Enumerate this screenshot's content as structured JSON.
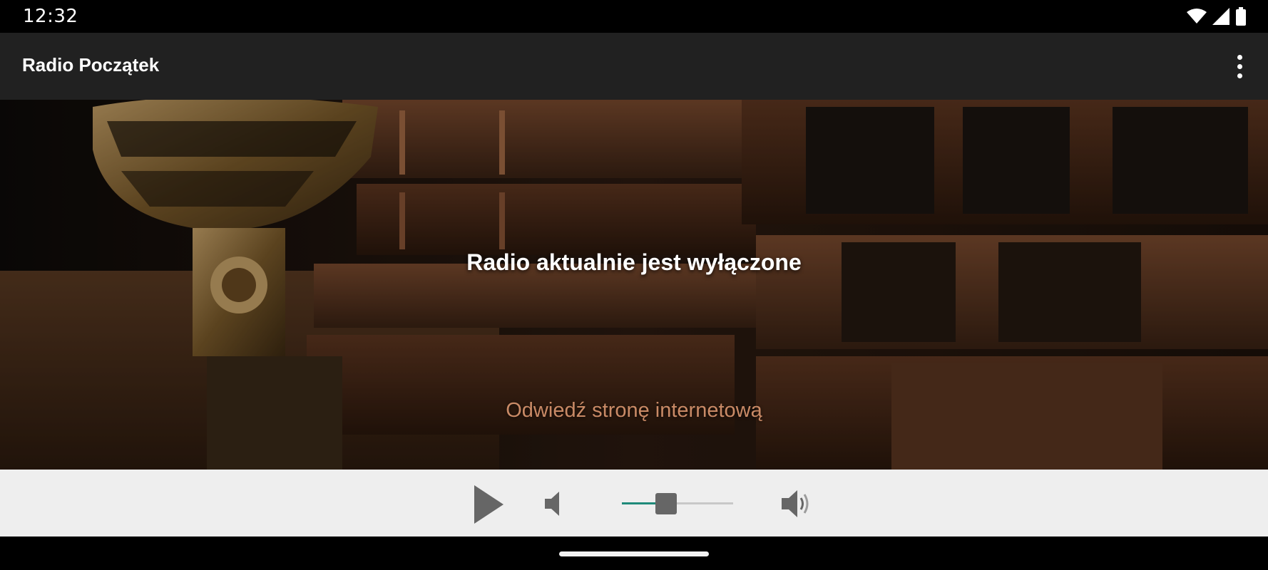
{
  "status_bar": {
    "time": "12:32",
    "icons": [
      "wifi-icon",
      "signal-icon",
      "battery-icon"
    ]
  },
  "app_bar": {
    "title": "Radio Początek",
    "menu_icon": "more-vertical-icon"
  },
  "hero": {
    "background_image": "microphone-and-old-books",
    "status_text": "Radio aktualnie jest wyłączone",
    "website_link": "Odwiedź stronę internetową",
    "link_color": "#c98a66"
  },
  "player": {
    "play_icon": "play-icon",
    "mute_icon": "volume-mute-icon",
    "volume_max_icon": "volume-up-icon",
    "volume_level": 0.4,
    "accent_color": "#1f8a7a"
  },
  "nav_bar": {
    "handle": "gesture-handle"
  }
}
